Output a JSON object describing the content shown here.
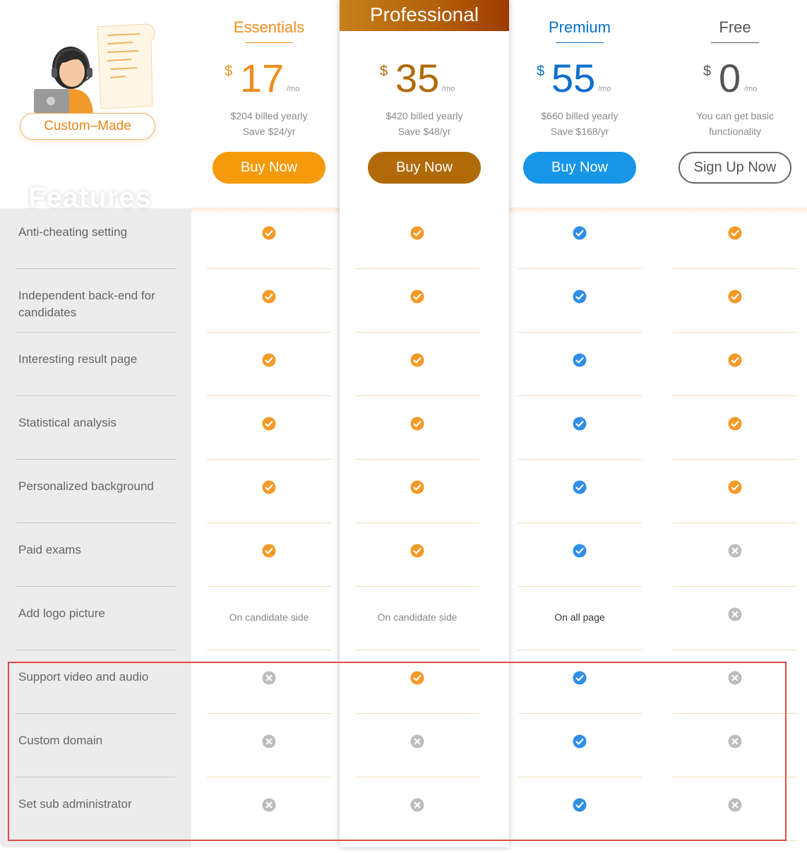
{
  "badge": {
    "label": "Custom–Made"
  },
  "features_title": "Features",
  "features": [
    "Anti-cheating setting",
    "Independent back-end for candidates",
    "Interesting result page",
    "Statistical analysis",
    "Personalized background",
    "Paid exams",
    "Add logo picture",
    "Support video and audio",
    "Custom domain",
    "Set sub administrator"
  ],
  "plans": [
    {
      "name": "Essentials",
      "currency": "$",
      "price": "17",
      "period": "/mo",
      "billing_line1": "$204 billed yearly",
      "billing_line2": "Save $24/yr",
      "cta": "Buy Now",
      "accent": "#f08c1e",
      "cells": [
        "check",
        "check",
        "check",
        "check",
        "check",
        "check",
        "On candidate side",
        "cross",
        "cross",
        "cross"
      ]
    },
    {
      "name": "Professional",
      "currency": "$",
      "price": "35",
      "period": "/mo",
      "billing_line1": "$420 billed yearly",
      "billing_line2": "Save $48/yr",
      "cta": "Buy Now",
      "accent": "#b06a07",
      "cells": [
        "check",
        "check",
        "check",
        "check",
        "check",
        "check",
        "On candidate side",
        "check",
        "cross",
        "cross"
      ]
    },
    {
      "name": "Premium",
      "currency": "$",
      "price": "55",
      "period": "/mo",
      "billing_line1": "$660 billed yearly",
      "billing_line2": "Save $168/yr",
      "cta": "Buy Now",
      "accent": "#0b6fcd",
      "cells": [
        "check",
        "check",
        "check",
        "check",
        "check",
        "check",
        "On all page",
        "check",
        "check",
        "check"
      ]
    },
    {
      "name": "Free",
      "currency": "$",
      "price": "0",
      "period": "/mo",
      "billing_line1": "You can get basic",
      "billing_line2": "functionality",
      "cta": "Sign Up Now",
      "accent": "#555555",
      "cells": [
        "check",
        "check",
        "check",
        "check",
        "check",
        "cross",
        "cross",
        "cross",
        "cross",
        "cross"
      ]
    }
  ],
  "colors": {
    "check_orange": "#f39a28",
    "check_blue": "#2f8ee6",
    "cross_gray": "#bdbdbd",
    "highlight": "#e04a4a"
  }
}
